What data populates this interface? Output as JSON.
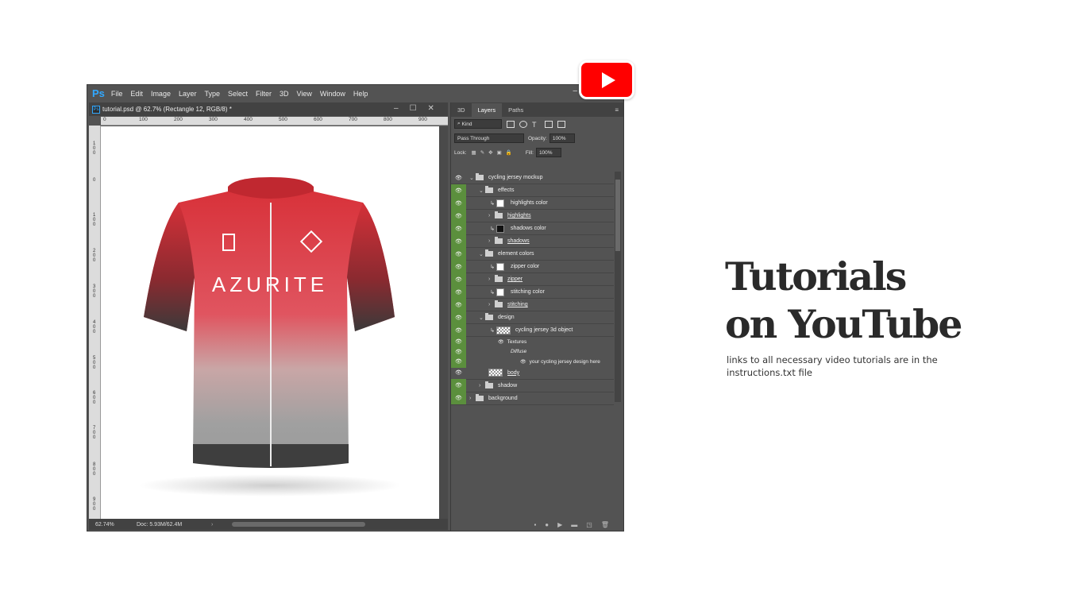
{
  "youtube": {
    "icon": "youtube-play-icon",
    "color": "#ff0000"
  },
  "photoshop": {
    "app_logo": "Ps",
    "menu": [
      "File",
      "Edit",
      "Image",
      "Layer",
      "Type",
      "Select",
      "Filter",
      "3D",
      "View",
      "Window",
      "Help"
    ],
    "minimize": "–",
    "document": {
      "tab_icon": "Ps",
      "title": "tutorial.psd @ 62.7% (Rectangle 12, RGB/8) *",
      "controls": [
        "–",
        "☐",
        "✕"
      ]
    },
    "ruler_top": [
      "0",
      "100",
      "200",
      "300",
      "400",
      "500",
      "600",
      "700",
      "800",
      "900"
    ],
    "ruler_left": [
      "100",
      "0",
      "100",
      "200",
      "300",
      "400",
      "500",
      "600",
      "700",
      "800",
      "900"
    ],
    "canvas": {
      "jersey_text": "AZURITE",
      "jersey_color_top": "#d8323a",
      "jersey_color_bottom": "#9a9a9a"
    },
    "status": {
      "zoom": "62.74%",
      "doc_info": "Doc: 5.93M/62.4M",
      "arrow": "›"
    },
    "panel": {
      "tabs": [
        "3D",
        "Layers",
        "Paths"
      ],
      "active_tab": "Layers",
      "filter_label": "Kind",
      "blend_mode": "Pass Through",
      "opacity_label": "Opacity:",
      "opacity_value": "100%",
      "lock_label": "Lock:",
      "fill_label": "Fill:",
      "fill_value": "100%",
      "layers": [
        {
          "name": "cycling jersey mockup",
          "type": "group",
          "indent": 0,
          "eye_green": false,
          "chevron": "⌄"
        },
        {
          "name": "effects",
          "type": "group",
          "indent": 1,
          "eye_green": true,
          "chevron": "⌄"
        },
        {
          "name": "highlights color",
          "type": "fill-white",
          "indent": 2,
          "eye_green": true
        },
        {
          "name": "highlights",
          "type": "group-closed",
          "indent": 2,
          "eye_green": true,
          "underline": true
        },
        {
          "name": "shadows color",
          "type": "fill-black",
          "indent": 2,
          "eye_green": true
        },
        {
          "name": "shadows",
          "type": "group-closed",
          "indent": 2,
          "eye_green": true,
          "underline": true
        },
        {
          "name": "element colors",
          "type": "group",
          "indent": 1,
          "eye_green": true,
          "chevron": "⌄"
        },
        {
          "name": "zipper color",
          "type": "fill-white",
          "indent": 2,
          "eye_green": true
        },
        {
          "name": "zipper",
          "type": "group-closed",
          "indent": 2,
          "eye_green": true,
          "underline": true
        },
        {
          "name": "stitching color",
          "type": "fill-white",
          "indent": 2,
          "eye_green": true
        },
        {
          "name": "stitching",
          "type": "group-closed",
          "indent": 2,
          "eye_green": true,
          "underline": true
        },
        {
          "name": "design",
          "type": "group",
          "indent": 1,
          "eye_green": true,
          "chevron": "⌄"
        },
        {
          "name": "cycling jersey 3d object",
          "type": "3d",
          "indent": 2,
          "eye_green": true
        },
        {
          "name": "Textures",
          "type": "sub",
          "indent": 3,
          "eye_green": true
        },
        {
          "name": "Diffuse",
          "type": "sub-italic",
          "indent": 4,
          "eye_green": true
        },
        {
          "name": "your cycling jersey design here",
          "type": "sub",
          "indent": 5,
          "eye_green": true
        },
        {
          "name": "body",
          "type": "smart",
          "indent": 2,
          "eye_green": false,
          "underline": true
        },
        {
          "name": "shadow",
          "type": "group-closed",
          "indent": 1,
          "eye_green": true
        },
        {
          "name": "background",
          "type": "group-closed",
          "indent": 0,
          "eye_green": true
        }
      ]
    }
  },
  "promo": {
    "headline_line1": "Tutorials",
    "headline_line2": "on YouTube",
    "subtext": "links to all necessary video tutorials are in the instructions.txt file"
  }
}
